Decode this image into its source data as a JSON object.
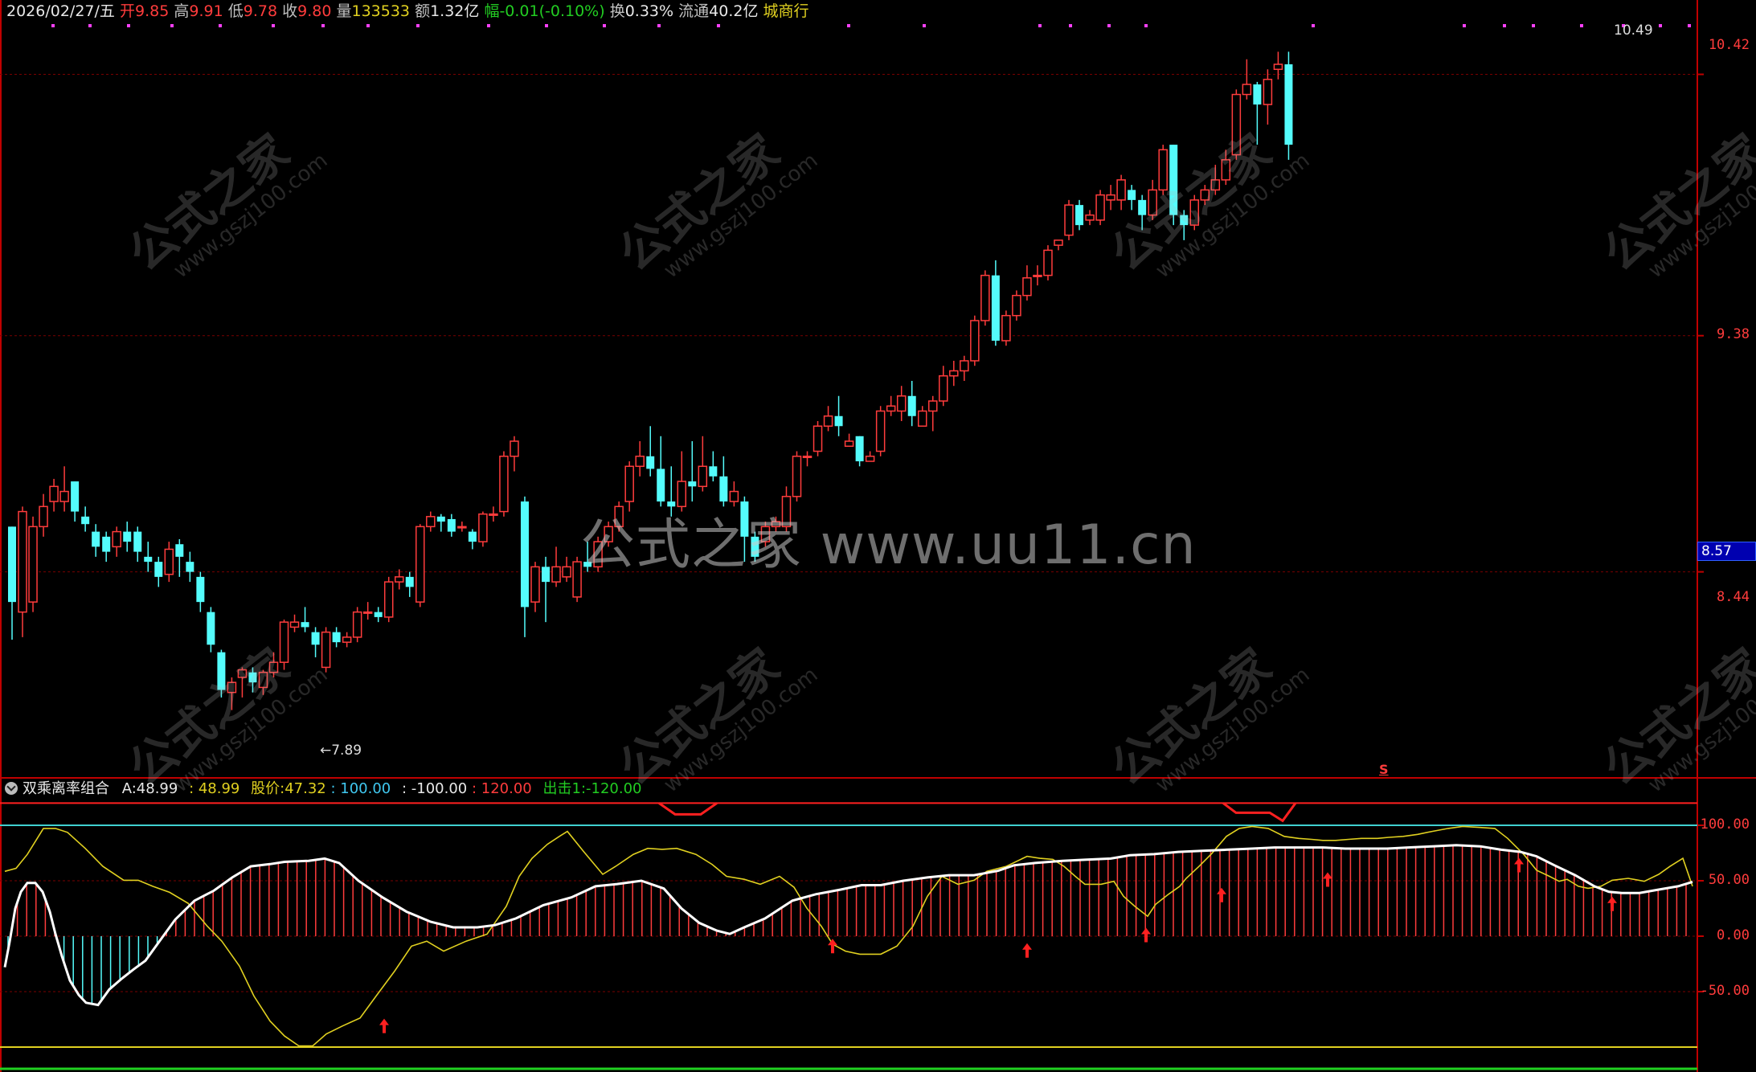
{
  "info_bar": {
    "date": "2026/02/27/五",
    "open_label": "开",
    "open": "9.85",
    "high_label": "高",
    "high": "9.91",
    "low_label": "低",
    "low": "9.78",
    "close_label": "收",
    "close": "9.80",
    "volume_label": "量",
    "volume": "133533",
    "amount_label": "额",
    "amount": "1.32亿",
    "change_label": "幅",
    "change": "-0.01(-0.10%)",
    "turnover_label": "换",
    "turnover": "0.33%",
    "float_label": "流通",
    "float_value": "40.2亿",
    "sector": "城商行"
  },
  "price_axis": {
    "labels": [
      "10.42",
      "9.38",
      "8.44"
    ],
    "current_price": "8.57"
  },
  "annotations": {
    "high_mark": "10.49",
    "low_mark": "←7.89",
    "s_mark": "S"
  },
  "watermark": {
    "center": "公式之家 www.uu11.cn",
    "tile_big": "公式之家",
    "tile_small": "www.gszj100.com"
  },
  "indicator": {
    "name": "双乘离率组合",
    "a_label": "A:",
    "a_value": "48.99",
    "b_value": ": 48.99",
    "price_label": "股价:",
    "price_value": "47.32",
    "v100": ": 100.00",
    "vneg100": ": -100.00",
    "v120": ": 120.00",
    "strike_label": "出击1:",
    "strike_value": "-120.00",
    "axis_labels": [
      "100.00",
      "50.00",
      "0.00",
      "-50.00"
    ]
  },
  "colors": {
    "up": "#ff3c3c",
    "down": "#54fcfc",
    "grid": "#7a0000",
    "line_yellow": "#e0d020",
    "line_white": "#ffffff",
    "line_cyan": "#40d0d0",
    "line_red": "#ff2020",
    "line_green": "#20d020",
    "magenta": "#ff40ff"
  },
  "chart_data": {
    "type": "candlestick",
    "price_range": [
      7.62,
      10.62
    ],
    "candles": [
      [
        8.62,
        8.32,
        8.17,
        8.62
      ],
      [
        8.28,
        8.68,
        8.18,
        8.7
      ],
      [
        8.32,
        8.62,
        8.28,
        8.66
      ],
      [
        8.62,
        8.7,
        8.58,
        8.75
      ],
      [
        8.72,
        8.78,
        8.68,
        8.81
      ],
      [
        8.72,
        8.76,
        8.68,
        8.86
      ],
      [
        8.8,
        8.68,
        8.64,
        8.8
      ],
      [
        8.66,
        8.63,
        8.6,
        8.7
      ],
      [
        8.6,
        8.54,
        8.5,
        8.63
      ],
      [
        8.58,
        8.52,
        8.48,
        8.6
      ],
      [
        8.54,
        8.6,
        8.5,
        8.62
      ],
      [
        8.6,
        8.56,
        8.52,
        8.64
      ],
      [
        8.6,
        8.52,
        8.48,
        8.62
      ],
      [
        8.5,
        8.48,
        8.44,
        8.56
      ],
      [
        8.48,
        8.42,
        8.38,
        8.5
      ],
      [
        8.43,
        8.53,
        8.4,
        8.56
      ],
      [
        8.55,
        8.5,
        8.42,
        8.57
      ],
      [
        8.48,
        8.44,
        8.4,
        8.52
      ],
      [
        8.42,
        8.32,
        8.28,
        8.44
      ],
      [
        8.28,
        8.15,
        8.12,
        8.3
      ],
      [
        8.12,
        7.97,
        7.94,
        8.13
      ],
      [
        7.96,
        8.0,
        7.89,
        8.02
      ],
      [
        8.02,
        8.05,
        7.94,
        8.06
      ],
      [
        8.04,
        8.0,
        7.96,
        8.06
      ],
      [
        7.98,
        8.04,
        7.95,
        8.05
      ],
      [
        8.04,
        8.08,
        8.02,
        8.12
      ],
      [
        8.08,
        8.24,
        8.05,
        8.25
      ],
      [
        8.22,
        8.24,
        8.2,
        8.27
      ],
      [
        8.24,
        8.22,
        8.2,
        8.3
      ],
      [
        8.2,
        8.15,
        8.1,
        8.22
      ],
      [
        8.06,
        8.2,
        8.04,
        8.22
      ],
      [
        8.2,
        8.16,
        8.14,
        8.22
      ],
      [
        8.16,
        8.18,
        8.14,
        8.2
      ],
      [
        8.18,
        8.28,
        8.16,
        8.3
      ],
      [
        8.28,
        8.28,
        8.25,
        8.32
      ],
      [
        8.28,
        8.26,
        8.24,
        8.3
      ],
      [
        8.26,
        8.4,
        8.24,
        8.42
      ],
      [
        8.4,
        8.42,
        8.37,
        8.45
      ],
      [
        8.42,
        8.38,
        8.34,
        8.44
      ],
      [
        8.32,
        8.62,
        8.3,
        8.63
      ],
      [
        8.62,
        8.66,
        8.6,
        8.68
      ],
      [
        8.66,
        8.64,
        8.6,
        8.67
      ],
      [
        8.65,
        8.6,
        8.58,
        8.67
      ],
      [
        8.62,
        8.62,
        8.6,
        8.64
      ],
      [
        8.6,
        8.56,
        8.53,
        8.61
      ],
      [
        8.56,
        8.67,
        8.54,
        8.68
      ],
      [
        8.67,
        8.67,
        8.64,
        8.7
      ],
      [
        8.68,
        8.9,
        8.66,
        8.92
      ],
      [
        8.9,
        8.96,
        8.84,
        8.98
      ],
      [
        8.72,
        8.3,
        8.18,
        8.74
      ],
      [
        8.32,
        8.46,
        8.28,
        8.48
      ],
      [
        8.46,
        8.4,
        8.24,
        8.5
      ],
      [
        8.4,
        8.46,
        8.38,
        8.54
      ],
      [
        8.42,
        8.46,
        8.4,
        8.5
      ],
      [
        8.34,
        8.48,
        8.32,
        8.5
      ],
      [
        8.48,
        8.46,
        8.44,
        8.56
      ],
      [
        8.46,
        8.56,
        8.44,
        8.58
      ],
      [
        8.56,
        8.62,
        8.54,
        8.64
      ],
      [
        8.62,
        8.7,
        8.6,
        8.72
      ],
      [
        8.72,
        8.86,
        8.68,
        8.88
      ],
      [
        8.86,
        8.9,
        8.82,
        8.96
      ],
      [
        8.9,
        8.85,
        8.82,
        9.02
      ],
      [
        8.85,
        8.72,
        8.7,
        8.98
      ],
      [
        8.72,
        8.7,
        8.66,
        8.86
      ],
      [
        8.7,
        8.8,
        8.68,
        8.92
      ],
      [
        8.8,
        8.78,
        8.72,
        8.96
      ],
      [
        8.78,
        8.86,
        8.76,
        8.98
      ],
      [
        8.86,
        8.82,
        8.8,
        8.92
      ],
      [
        8.82,
        8.72,
        8.7,
        8.9
      ],
      [
        8.72,
        8.76,
        8.7,
        8.8
      ],
      [
        8.72,
        8.58,
        8.48,
        8.74
      ],
      [
        8.58,
        8.5,
        8.48,
        8.6
      ],
      [
        8.56,
        8.62,
        8.54,
        8.64
      ],
      [
        8.62,
        8.64,
        8.6,
        8.66
      ],
      [
        8.62,
        8.74,
        8.6,
        8.78
      ],
      [
        8.74,
        8.9,
        8.72,
        8.92
      ],
      [
        8.9,
        8.9,
        8.86,
        8.92
      ],
      [
        8.92,
        9.02,
        8.9,
        9.04
      ],
      [
        9.02,
        9.06,
        9.0,
        9.1
      ],
      [
        9.06,
        9.02,
        8.98,
        9.14
      ],
      [
        8.94,
        8.96,
        8.94,
        8.99
      ],
      [
        8.98,
        8.88,
        8.86,
        8.98
      ],
      [
        8.88,
        8.9,
        8.88,
        8.92
      ],
      [
        8.92,
        9.08,
        8.9,
        9.1
      ],
      [
        9.08,
        9.1,
        9.06,
        9.14
      ],
      [
        9.08,
        9.14,
        9.04,
        9.18
      ],
      [
        9.14,
        9.06,
        9.02,
        9.2
      ],
      [
        9.02,
        9.08,
        9.02,
        9.1
      ],
      [
        9.08,
        9.12,
        9.0,
        9.14
      ],
      [
        9.12,
        9.22,
        9.1,
        9.26
      ],
      [
        9.22,
        9.24,
        9.18,
        9.28
      ],
      [
        9.24,
        9.28,
        9.2,
        9.3
      ],
      [
        9.28,
        9.44,
        9.26,
        9.46
      ],
      [
        9.44,
        9.62,
        9.42,
        9.64
      ],
      [
        9.62,
        9.36,
        9.34,
        9.68
      ],
      [
        9.36,
        9.46,
        9.34,
        9.48
      ],
      [
        9.46,
        9.54,
        9.44,
        9.56
      ],
      [
        9.54,
        9.61,
        9.52,
        9.66
      ],
      [
        9.62,
        9.62,
        9.58,
        9.66
      ],
      [
        9.62,
        9.72,
        9.6,
        9.74
      ],
      [
        9.74,
        9.76,
        9.72,
        9.76
      ],
      [
        9.78,
        9.9,
        9.76,
        9.92
      ],
      [
        9.9,
        9.82,
        9.8,
        9.92
      ],
      [
        9.84,
        9.86,
        9.82,
        9.88
      ],
      [
        9.84,
        9.94,
        9.82,
        9.96
      ],
      [
        9.92,
        9.94,
        9.88,
        9.98
      ],
      [
        9.92,
        10.0,
        9.88,
        10.02
      ],
      [
        9.96,
        9.92,
        9.88,
        9.98
      ],
      [
        9.92,
        9.86,
        9.8,
        9.94
      ],
      [
        9.86,
        9.96,
        9.84,
        10.0
      ],
      [
        9.96,
        10.12,
        9.94,
        10.14
      ],
      [
        10.14,
        9.86,
        9.82,
        10.14
      ],
      [
        9.86,
        9.82,
        9.76,
        9.88
      ],
      [
        9.82,
        9.92,
        9.8,
        9.94
      ],
      [
        9.92,
        9.96,
        9.9,
        9.98
      ],
      [
        9.96,
        10.0,
        9.94,
        10.06
      ],
      [
        10.0,
        10.08,
        9.98,
        10.12
      ],
      [
        10.1,
        10.34,
        10.08,
        10.36
      ],
      [
        10.34,
        10.38,
        10.32,
        10.48
      ],
      [
        10.38,
        10.3,
        10.14,
        10.39
      ],
      [
        10.3,
        10.4,
        10.22,
        10.44
      ],
      [
        10.44,
        10.46,
        10.4,
        10.51
      ],
      [
        10.46,
        10.14,
        10.08,
        10.51
      ]
    ]
  }
}
